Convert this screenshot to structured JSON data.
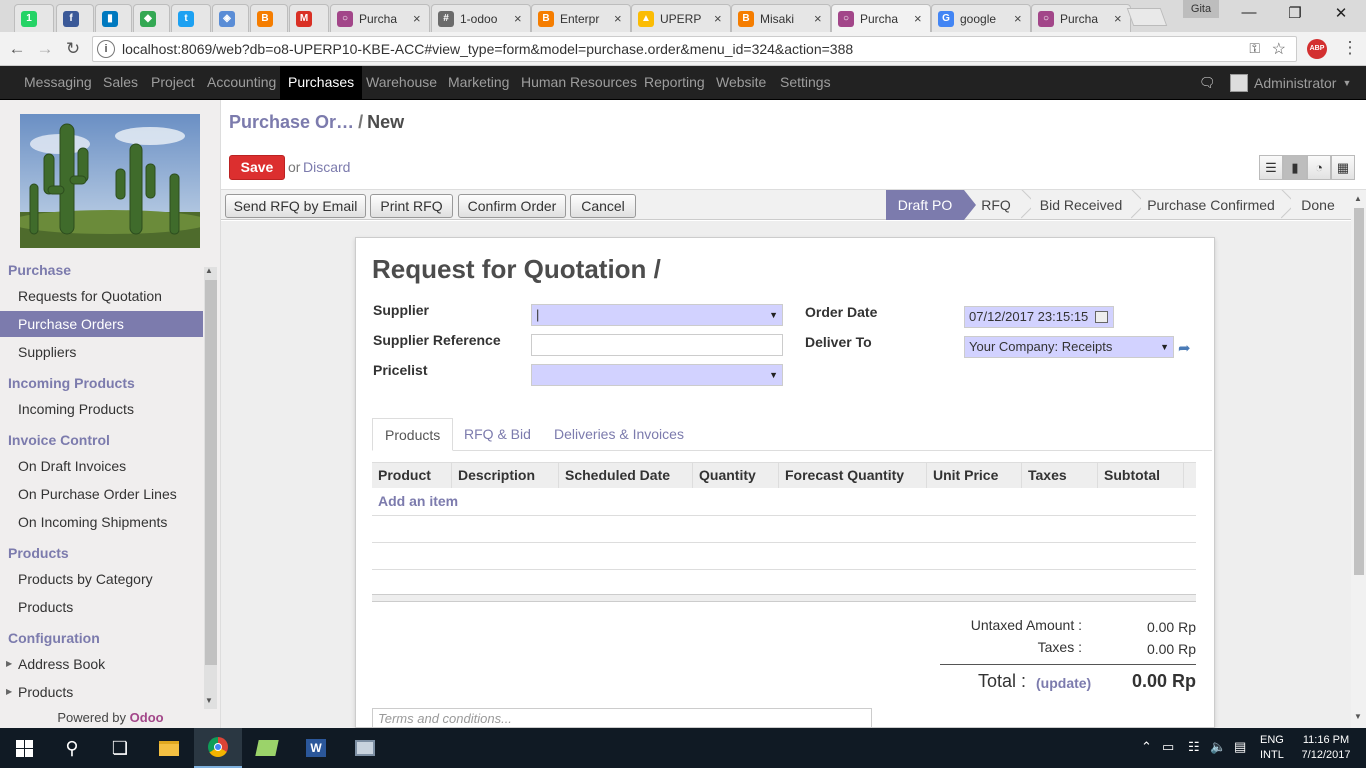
{
  "browser": {
    "tabs": [
      {
        "title": "",
        "icon": "whatsapp-icon",
        "color": "#25d366",
        "glyph": "1"
      },
      {
        "title": "",
        "icon": "facebook-icon",
        "color": "#3b5998",
        "glyph": "f"
      },
      {
        "title": "",
        "icon": "trello-icon",
        "color": "#0079bf",
        "glyph": "▮"
      },
      {
        "title": "",
        "icon": "maps-icon",
        "color": "#34a853",
        "glyph": "◆"
      },
      {
        "title": "",
        "icon": "twitter-icon",
        "color": "#1da1f2",
        "glyph": "t"
      },
      {
        "title": "",
        "icon": "cube-icon",
        "color": "#5a8dd6",
        "glyph": "◈"
      },
      {
        "title": "",
        "icon": "blogger-icon",
        "color": "#f57d00",
        "glyph": "B"
      },
      {
        "title": "",
        "icon": "gmail-icon",
        "color": "#d93025",
        "glyph": "M"
      },
      {
        "title": "Purcha",
        "icon": "odoo-icon",
        "color": "#a24689",
        "glyph": "○"
      },
      {
        "title": "1-odoo",
        "icon": "hashtag-icon",
        "color": "#6b6b6b",
        "glyph": "#"
      },
      {
        "title": "Enterpr",
        "icon": "blogger-icon",
        "color": "#f57d00",
        "glyph": "B"
      },
      {
        "title": "UPERP",
        "icon": "drive-icon",
        "color": "#fbbc04",
        "glyph": "▲"
      },
      {
        "title": "Misaki",
        "icon": "blogger-icon",
        "color": "#f57d00",
        "glyph": "B"
      },
      {
        "title": "Purcha",
        "icon": "odoo-icon",
        "color": "#a24689",
        "glyph": "○"
      },
      {
        "title": "google",
        "icon": "google-icon",
        "color": "#4285f4",
        "glyph": "G"
      },
      {
        "title": "Purcha",
        "icon": "odoo-icon",
        "color": "#a24689",
        "glyph": "○"
      }
    ],
    "active_tab": 13,
    "window_user": "Gita",
    "url": "localhost:8069/web?db=o8-UPERP10-KBE-ACC#view_type=form&model=purchase.order&menu_id=324&action=388",
    "abp": "ABP"
  },
  "topmenu": {
    "items": [
      "Messaging",
      "Sales",
      "Project",
      "Accounting",
      "Purchases",
      "Warehouse",
      "Marketing",
      "Human Resources",
      "Reporting",
      "Website",
      "Settings"
    ],
    "active": "Purchases",
    "user": "Administrator"
  },
  "sidebar": {
    "sections": [
      {
        "title": "Purchase",
        "items": [
          "Requests for Quotation",
          "Purchase Orders",
          "Suppliers"
        ]
      },
      {
        "title": "Incoming Products",
        "items": [
          "Incoming Products"
        ]
      },
      {
        "title": "Invoice Control",
        "items": [
          "On Draft Invoices",
          "On Purchase Order Lines",
          "On Incoming Shipments"
        ]
      },
      {
        "title": "Products",
        "items": [
          "Products by Category",
          "Products"
        ]
      },
      {
        "title": "Configuration",
        "items": [
          "Address Book",
          "Products"
        ]
      }
    ],
    "active_item": "Purchase Orders",
    "powered_by": "Powered by",
    "brand": "Odoo"
  },
  "breadcrumb": {
    "parent": "Purchase Or…",
    "separator": "/",
    "current": "New"
  },
  "form_actions": {
    "save": "Save",
    "or": "or",
    "discard": "Discard"
  },
  "header_buttons": [
    "Send RFQ by Email",
    "Print RFQ",
    "Confirm Order",
    "Cancel"
  ],
  "stages": {
    "items": [
      "Draft PO",
      "RFQ",
      "Bid Received",
      "Purchase Confirmed",
      "Done"
    ],
    "active": "Draft PO"
  },
  "form": {
    "title": "Request for Quotation /",
    "supplier_label": "Supplier",
    "supplier_value": "|",
    "supplier_ref_label": "Supplier Reference",
    "supplier_ref_value": "",
    "pricelist_label": "Pricelist",
    "pricelist_value": "",
    "order_date_label": "Order Date",
    "order_date_value": "07/12/2017 23:15:15",
    "deliver_to_label": "Deliver To",
    "deliver_to_value": "Your Company: Receipts"
  },
  "notebook": {
    "tabs": [
      "Products",
      "RFQ & Bid",
      "Deliveries & Invoices"
    ],
    "active": "Products"
  },
  "order_lines": {
    "columns": [
      "Product",
      "Description",
      "Scheduled Date",
      "Quantity",
      "Forecast Quantity",
      "Unit Price",
      "Taxes",
      "Subtotal"
    ],
    "add_item": "Add an item"
  },
  "totals": {
    "untaxed_label": "Untaxed Amount :",
    "untaxed_value": "0.00 Rp",
    "taxes_label": "Taxes :",
    "taxes_value": "0.00 Rp",
    "total_label": "Total :",
    "update": "(update)",
    "total_value": "0.00 Rp"
  },
  "terms_placeholder": "Terms and conditions...",
  "taskbar": {
    "lang_line1": "ENG",
    "lang_line2": "INTL",
    "time": "11:16 PM",
    "date": "7/12/2017"
  },
  "colors": {
    "accent": "#7c7bad",
    "save": "#dc2f2f",
    "required": "#d2d2ff",
    "topbar": "#222222"
  }
}
